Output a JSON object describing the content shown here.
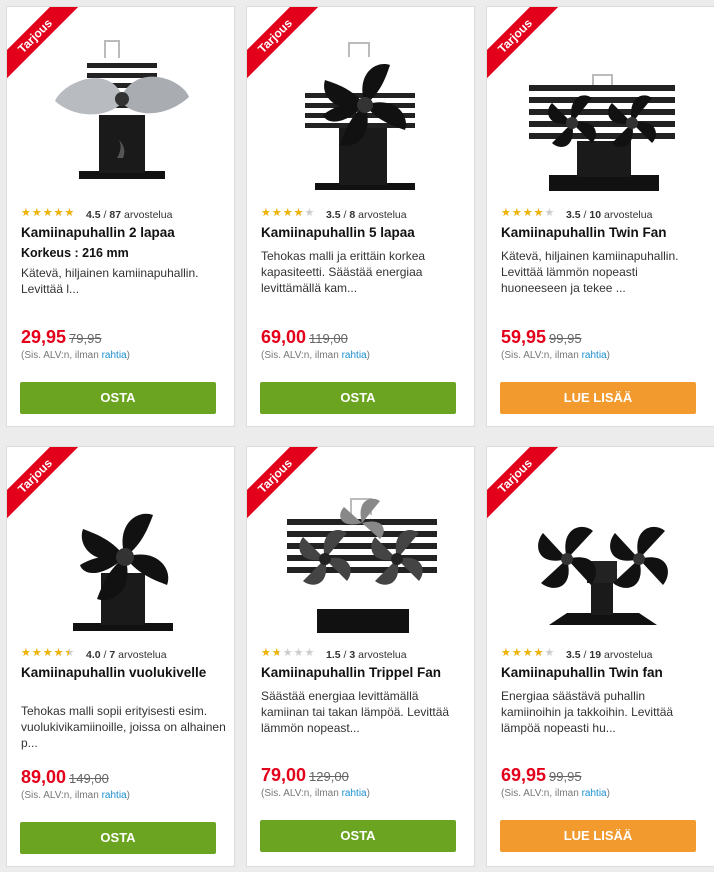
{
  "colors": {
    "sale_ribbon": "#e3001b",
    "buy_button": "#6aa421",
    "read_more_button": "#f29a2e",
    "link": "#1a8fd0",
    "price": "#e3001b"
  },
  "products": [
    {
      "ribbon": "Tarjous",
      "image": "stove-fan-2-blades",
      "rating": 4.5,
      "rating_text": "4.5",
      "separator": "/",
      "review_count": "87",
      "reviews_word": "arvostelua",
      "title": "Kamiinapuhallin 2 lapaa",
      "spec": "Korkeus : 216 mm",
      "description": "Kätevä, hiljainen kamiinapuhallin. Levittää l...",
      "price": "29,95",
      "old_price": "79,95",
      "vat_note": "(Sis. ALV:n,  ilman",
      "shipping_link": "rahtia",
      "vat_close": ")",
      "button": "OSTA"
    },
    {
      "ribbon": "Tarjous",
      "image": "stove-fan-5-blades",
      "rating": 3.5,
      "rating_text": "3.5",
      "separator": "/",
      "review_count": "8",
      "reviews_word": "arvostelua",
      "title": "Kamiinapuhallin 5 lapaa",
      "spec": "",
      "description": "Tehokas malli ja erittäin korkea kapasiteetti. Säästää energiaa levittämällä kam...",
      "price": "69,00",
      "old_price": "119,00",
      "vat_note": "(Sis. ALV:n,  ilman",
      "shipping_link": "rahtia",
      "vat_close": ")",
      "button": "OSTA"
    },
    {
      "ribbon": "Tarjous",
      "image": "stove-fan-twin",
      "rating": 3.5,
      "rating_text": "3.5",
      "separator": "/",
      "review_count": "10",
      "reviews_word": "arvostelua",
      "title": "Kamiinapuhallin Twin Fan",
      "spec": "",
      "description": "Kätevä, hiljainen kamiinapuhallin. Levittää lämmön nopeasti huoneeseen ja tekee ...",
      "price": "59,95",
      "old_price": "99,95",
      "vat_note": "(Sis. ALV:n,  ilman",
      "shipping_link": "rahtia",
      "vat_close": ")",
      "button": "LUE LISÄÄ"
    },
    {
      "ribbon": "Tarjous",
      "image": "flue-pipe-fan",
      "rating": 4.0,
      "rating_text": "4.0",
      "separator": "/",
      "review_count": "7",
      "reviews_word": "arvostelua",
      "title": "Kamiinapuhallin vuolukivelle",
      "spec": "",
      "description": "Tehokas malli sopii erityisesti esim. vuolukivikamiinoille, joissa on alhainen p...",
      "price": "89,00",
      "old_price": "149,00",
      "vat_note": "(Sis. ALV:n,  ilman",
      "shipping_link": "rahtia",
      "vat_close": ")",
      "button": "OSTA"
    },
    {
      "ribbon": "Tarjous",
      "image": "stove-fan-triple",
      "rating": 1.5,
      "rating_text": "1.5",
      "separator": "/",
      "review_count": "3",
      "reviews_word": "arvostelua",
      "title": "Kamiinapuhallin Trippel Fan",
      "spec": "",
      "description": "Säästää energiaa levittämällä kamiinan tai takan lämpöä. Levittää lämmön nopeast...",
      "price": "79,00",
      "old_price": "129,00",
      "vat_note": "(Sis. ALV:n,  ilman",
      "shipping_link": "rahtia",
      "vat_close": ")",
      "button": "OSTA"
    },
    {
      "ribbon": "Tarjous",
      "image": "stove-fan-twin-compact",
      "rating": 3.5,
      "rating_text": "3.5",
      "separator": "/",
      "review_count": "19",
      "reviews_word": "arvostelua",
      "title": "Kamiinapuhallin Twin fan",
      "spec": "",
      "description": "Energiaa säästävä puhallin kamiinoihin ja takkoihin. Levittää lämpöä nopeasti hu...",
      "price": "69,95",
      "old_price": "99,95",
      "vat_note": "(Sis. ALV:n,  ilman",
      "shipping_link": "rahtia",
      "vat_close": ")",
      "button": "LUE LISÄÄ"
    }
  ]
}
